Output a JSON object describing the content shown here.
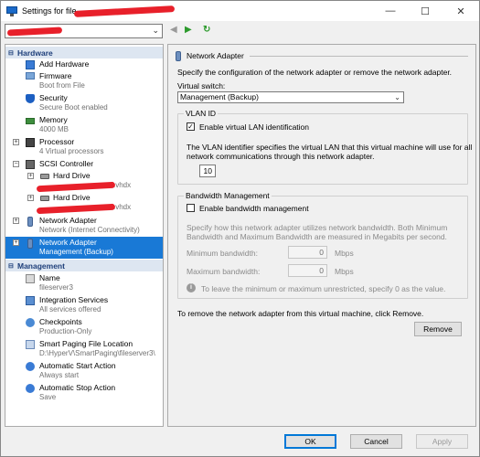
{
  "window": {
    "title": "Settings for file",
    "minimize_glyph": "—",
    "maximize_glyph": "☐",
    "close_glyph": "✕"
  },
  "toolbar": {
    "vm_select_chevron": "⌄",
    "back_glyph": "◀",
    "forward_glyph": "▶",
    "refresh_glyph": "↻"
  },
  "tree": {
    "hardware_header": "Hardware",
    "management_header": "Management",
    "collapse_glyph": "⊟",
    "expand_glyph": "+",
    "hardware_items": [
      {
        "label": "Add Hardware",
        "sub": ""
      },
      {
        "label": "Firmware",
        "sub": "Boot from File"
      },
      {
        "label": "Security",
        "sub": "Secure Boot enabled"
      },
      {
        "label": "Memory",
        "sub": "4000 MB"
      },
      {
        "label": "Processor",
        "sub": "4 Virtual processors"
      },
      {
        "label": "SCSI Controller",
        "sub": ""
      },
      {
        "label": "Hard Drive",
        "sub": ".vhdx"
      },
      {
        "label": "Hard Drive",
        "sub": ".vhdx"
      },
      {
        "label": "Network Adapter",
        "sub": "Network (Internet Connectivity)"
      },
      {
        "label": "Network Adapter",
        "sub": "Management (Backup)"
      }
    ],
    "management_items": [
      {
        "label": "Name",
        "sub": "fileserver3"
      },
      {
        "label": "Integration Services",
        "sub": "All services offered"
      },
      {
        "label": "Checkpoints",
        "sub": "Production-Only"
      },
      {
        "label": "Smart Paging File Location",
        "sub": "D:\\HyperV\\SmartPaging\\fileserver3\\"
      },
      {
        "label": "Automatic Start Action",
        "sub": "Always start"
      },
      {
        "label": "Automatic Stop Action",
        "sub": "Save"
      }
    ]
  },
  "detail": {
    "header": "Network Adapter",
    "intro": "Specify the configuration of the network adapter or remove the network adapter.",
    "virtual_switch_label": "Virtual switch:",
    "virtual_switch_value": "Management (Backup)",
    "combo_chevron": "⌄",
    "vlan_group": "VLAN ID",
    "vlan_checkbox_label": "Enable virtual LAN identification",
    "vlan_checked_glyph": "✓",
    "vlan_desc_line1": "The VLAN identifier specifies the virtual LAN that this virtual machine will use for all",
    "vlan_desc_line2": "network communications through this network adapter.",
    "vlan_id_value": "10",
    "bandwidth_group": "Bandwidth Management",
    "bandwidth_checkbox_label": "Enable bandwidth management",
    "bandwidth_desc_line1": "Specify how this network adapter utilizes network bandwidth. Both Minimum",
    "bandwidth_desc_line2": "Bandwidth and Maximum Bandwidth are measured in Megabits per second.",
    "min_bw_label": "Minimum bandwidth:",
    "min_bw_value": "0",
    "max_bw_label": "Maximum bandwidth:",
    "max_bw_value": "0",
    "unit_label": "Mbps",
    "info_glyph": "i",
    "unrestricted_note": "To leave the minimum or maximum unrestricted, specify 0 as the value.",
    "remove_note": "To remove the network adapter from this virtual machine, click Remove.",
    "remove_button": "Remove"
  },
  "footer": {
    "ok": "OK",
    "cancel": "Cancel",
    "apply": "Apply"
  }
}
